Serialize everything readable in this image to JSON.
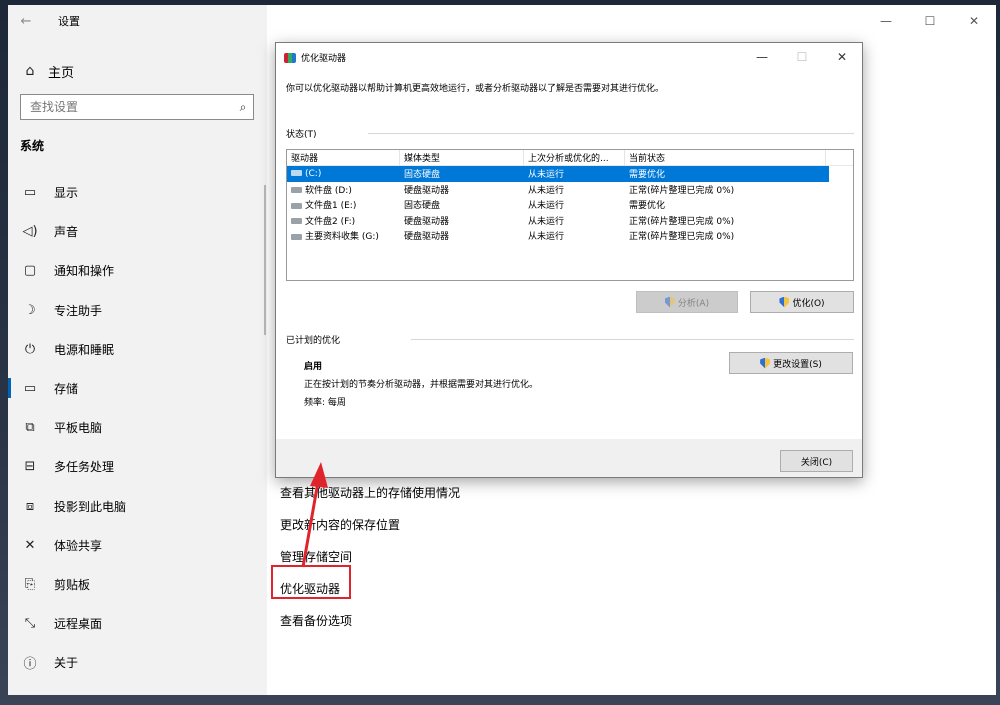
{
  "window": {
    "title": "设置",
    "back_label": "←",
    "controls": {
      "minimize": "—",
      "maximize": "☐",
      "close": "✕"
    }
  },
  "sidebar": {
    "home": {
      "label": "主页",
      "icon": "home-icon"
    },
    "search": {
      "placeholder": "查找设置",
      "icon": "search-icon"
    },
    "section_title": "系统",
    "items": [
      {
        "label": "显示",
        "icon": "monitor-icon",
        "glyph": "▭"
      },
      {
        "label": "声音",
        "icon": "speaker-icon",
        "glyph": "◁)"
      },
      {
        "label": "通知和操作",
        "icon": "notification-icon",
        "glyph": "▢"
      },
      {
        "label": "专注助手",
        "icon": "moon-icon",
        "glyph": "☽"
      },
      {
        "label": "电源和睡眠",
        "icon": "power-icon",
        "glyph": "⏻"
      },
      {
        "label": "存储",
        "icon": "storage-icon",
        "glyph": "▭",
        "active": true
      },
      {
        "label": "平板电脑",
        "icon": "tablet-icon",
        "glyph": "⧉"
      },
      {
        "label": "多任务处理",
        "icon": "multitask-icon",
        "glyph": "⊟"
      },
      {
        "label": "投影到此电脑",
        "icon": "project-icon",
        "glyph": "⧈"
      },
      {
        "label": "体验共享",
        "icon": "share-icon",
        "glyph": "✕"
      },
      {
        "label": "剪贴板",
        "icon": "clipboard-icon",
        "glyph": "⎘"
      },
      {
        "label": "远程桌面",
        "icon": "remote-desktop-icon",
        "glyph": "⤡"
      },
      {
        "label": "关于",
        "icon": "info-icon",
        "glyph": "ⓘ"
      }
    ]
  },
  "main": {
    "links": [
      "查看其他驱动器上的存储使用情况",
      "更改新内容的保存位置",
      "管理存储空间",
      "优化驱动器",
      "查看备份选项"
    ],
    "highlighted_link": "优化驱动器",
    "highlight_color": "#e0242c"
  },
  "dialog": {
    "title": "优化驱动器",
    "controls": {
      "minimize": "—",
      "maximize": "☐",
      "close": "✕"
    },
    "description": "你可以优化驱动器以帮助计算机更高效地运行，或者分析驱动器以了解是否需要对其进行优化。",
    "status_label": "状态(T)",
    "columns": [
      "驱动器",
      "媒体类型",
      "上次分析或优化的...",
      "当前状态"
    ],
    "drives": [
      {
        "name": "(C:)",
        "media": "固态硬盘",
        "last": "从未运行",
        "status": "需要优化",
        "selected": true
      },
      {
        "name": "软件盘 (D:)",
        "media": "硬盘驱动器",
        "last": "从未运行",
        "status": "正常(碎片整理已完成 0%)"
      },
      {
        "name": "文件盘1 (E:)",
        "media": "固态硬盘",
        "last": "从未运行",
        "status": "需要优化"
      },
      {
        "name": "文件盘2 (F:)",
        "media": "硬盘驱动器",
        "last": "从未运行",
        "status": "正常(碎片整理已完成 0%)"
      },
      {
        "name": "主要资料收集 (G:)",
        "media": "硬盘驱动器",
        "last": "从未运行",
        "status": "正常(碎片整理已完成 0%)"
      }
    ],
    "analyze_button": "分析(A)",
    "optimize_button": "优化(O)",
    "scheduled_label": "已计划的优化",
    "scheduled_state": "启用",
    "scheduled_desc": "正在按计划的节奏分析驱动器，并根据需要对其进行优化。",
    "frequency": "频率: 每周",
    "change_settings_button": "更改设置(S)",
    "close_button": "关闭(C)",
    "selection_color": "#0078d7"
  }
}
